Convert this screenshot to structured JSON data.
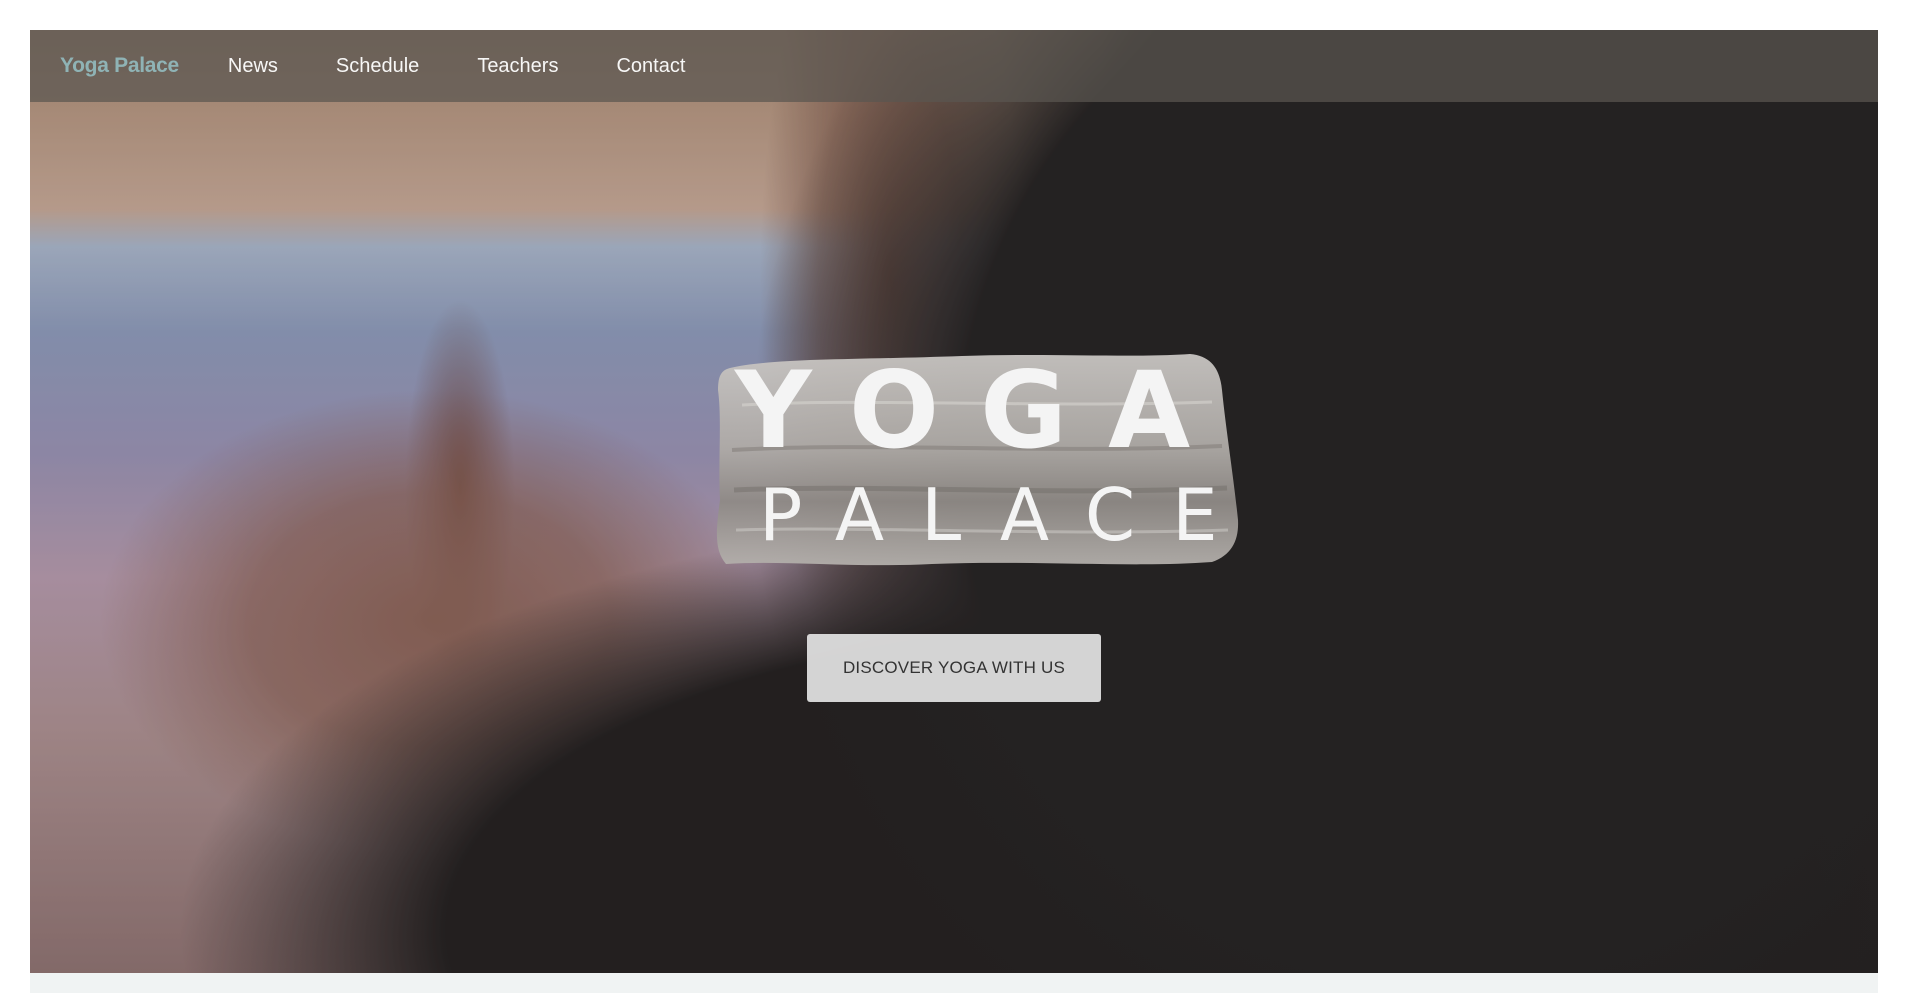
{
  "navbar": {
    "brand": "Yoga Palace",
    "links": [
      {
        "label": "News"
      },
      {
        "label": "Schedule"
      },
      {
        "label": "Teachers"
      },
      {
        "label": "Contact"
      }
    ]
  },
  "hero": {
    "logo_line1": "YOGA",
    "logo_line2": "PALACE",
    "cta_label": "DISCOVER YOGA WITH US"
  },
  "colors": {
    "brand": "#8fb3b5",
    "nav_bg": "#5a5650",
    "cta_bg": "#dedede",
    "cta_text": "#333333"
  }
}
